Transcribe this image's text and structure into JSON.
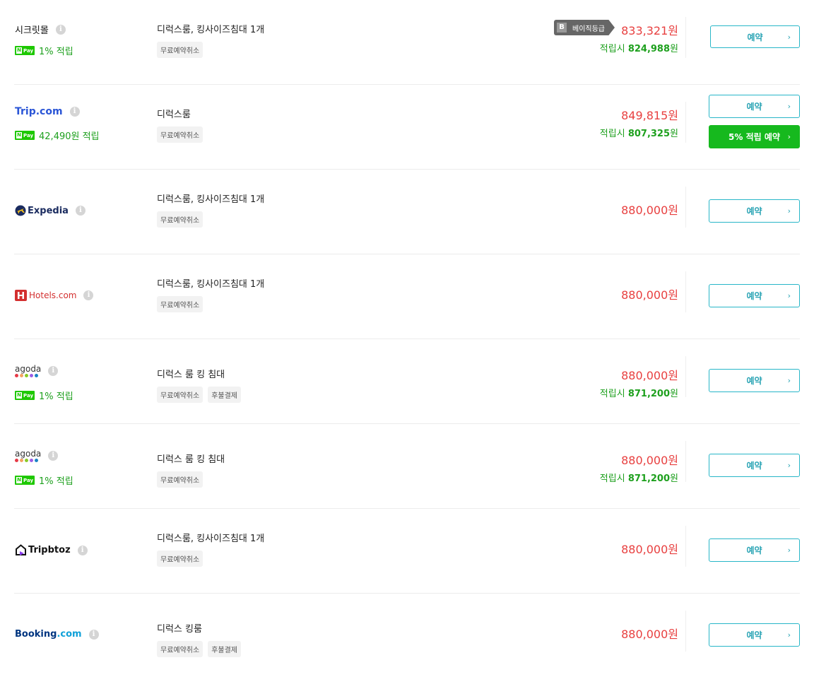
{
  "colors": {
    "price_red": "#e84040",
    "reward_green": "#1ea01e",
    "button_teal": "#28b6c8",
    "button_green": "#16b91e",
    "tripcom_blue": "#2a55d6",
    "expedia_navy": "#1a2b5f",
    "hotels_red": "#d32f2f",
    "booking_navy": "#003580",
    "booking_blue": "#0fa0d8"
  },
  "common": {
    "book_label": "예약",
    "npay_badge": "Pay",
    "npay_n": "N",
    "info_glyph": "i",
    "chevron": "›",
    "points_prefix": "적립시 "
  },
  "offers": [
    {
      "vendor": "시크릿몰",
      "reward": "1% 적립",
      "room": "디럭스룸, 킹사이즈침대 1개",
      "tags": [
        "무료예약취소"
      ],
      "badge_letter": "B",
      "badge_text": "베이직등급",
      "price": "833,321원",
      "points_amount": "824,988",
      "points_unit": "원"
    },
    {
      "vendor": "Trip.com",
      "reward": "42,490원 적립",
      "room": "디럭스룸",
      "tags": [
        "무료예약취소"
      ],
      "price": "849,815원",
      "points_amount": "807,325",
      "points_unit": "원",
      "extra_button": "5% 적립 예약"
    },
    {
      "vendor": "Expedia",
      "room": "디럭스룸, 킹사이즈침대 1개",
      "tags": [
        "무료예약취소"
      ],
      "price": "880,000원"
    },
    {
      "vendor": "Hotels.com",
      "room": "디럭스룸, 킹사이즈침대 1개",
      "tags": [
        "무료예약취소"
      ],
      "price": "880,000원"
    },
    {
      "vendor": "agoda",
      "reward": "1% 적립",
      "room": "디럭스 룸 킹 침대",
      "tags": [
        "무료예약취소",
        "후불결제"
      ],
      "price": "880,000원",
      "points_amount": "871,200",
      "points_unit": "원"
    },
    {
      "vendor": "agoda",
      "reward": "1% 적립",
      "room": "디럭스 룸 킹 침대",
      "tags": [
        "무료예약취소"
      ],
      "price": "880,000원",
      "points_amount": "871,200",
      "points_unit": "원"
    },
    {
      "vendor": "Tripbtoz",
      "room": "디럭스룸, 킹사이즈침대 1개",
      "tags": [
        "무료예약취소"
      ],
      "price": "880,000원"
    },
    {
      "vendor_a": "Booking",
      "vendor_b": ".com",
      "room": "디럭스 킹룸",
      "tags": [
        "무료예약취소",
        "후불결제"
      ],
      "price": "880,000원"
    }
  ]
}
